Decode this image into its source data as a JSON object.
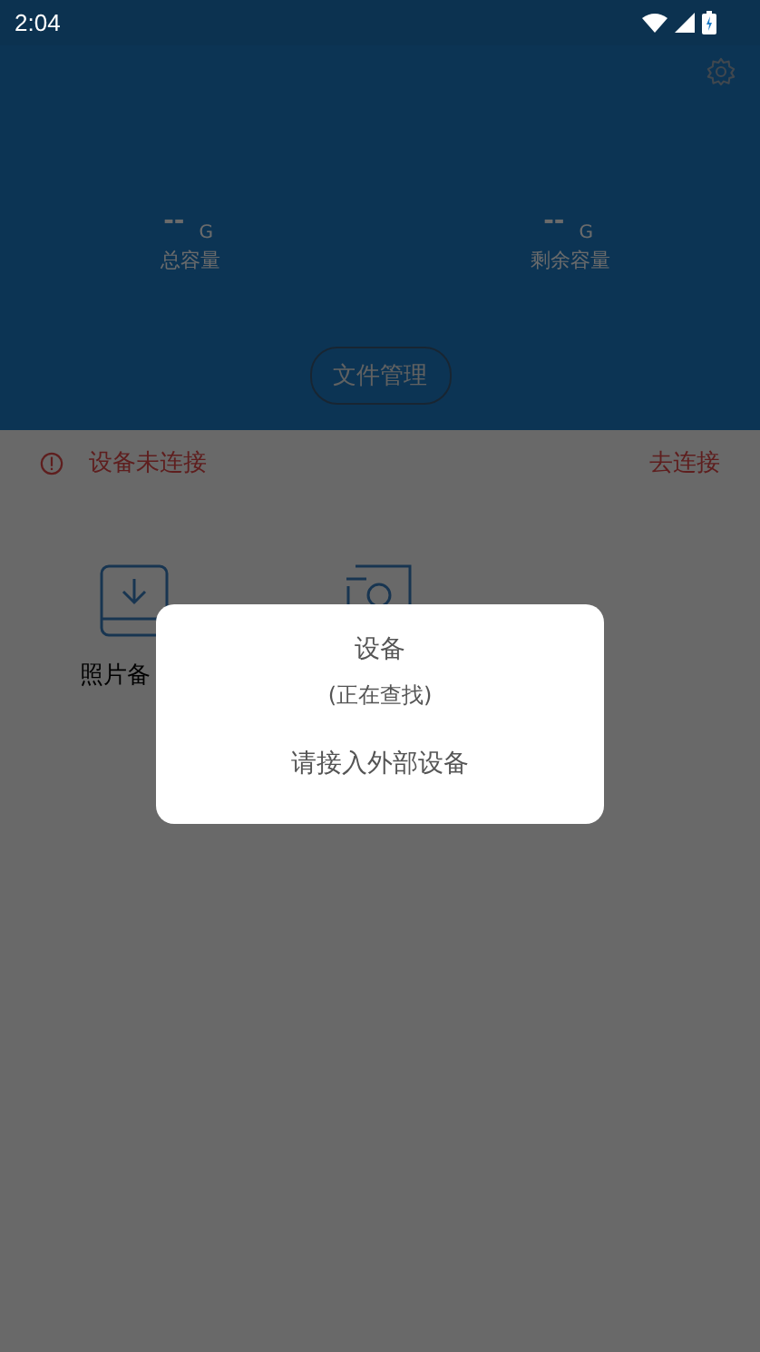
{
  "status_bar": {
    "time": "2:04"
  },
  "storage": [
    {
      "value": "--",
      "unit": "G",
      "label": "总容量"
    },
    {
      "value": "--",
      "unit": "G",
      "label": "剩余容量"
    }
  ],
  "file_button": "文件管理",
  "connection": {
    "connected": false,
    "message": "设备未连接",
    "action": "去连接"
  },
  "tiles": [
    {
      "kind": "backup",
      "label": "照片备"
    },
    {
      "kind": "camera"
    }
  ],
  "dialog": {
    "title": "设备",
    "subtitle": "(正在查找)",
    "message": "请接入外部设备"
  }
}
